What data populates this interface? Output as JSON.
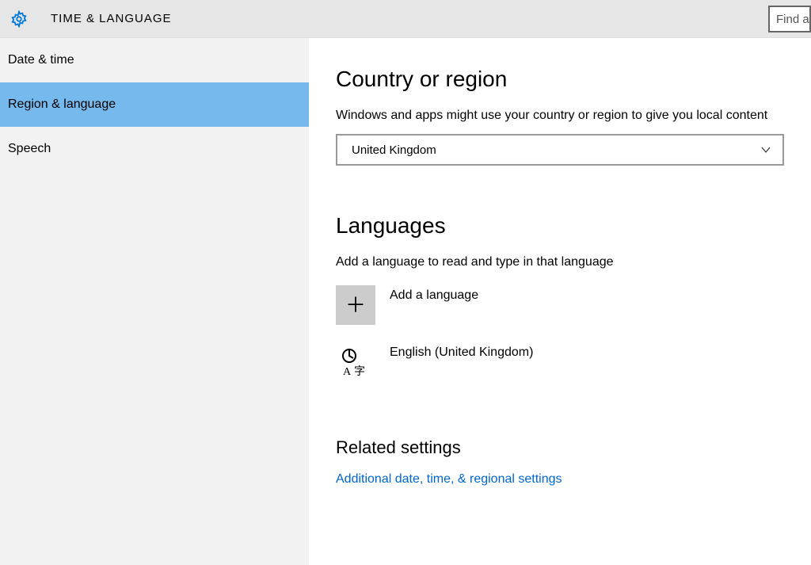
{
  "header": {
    "title": "TIME & LANGUAGE",
    "search_placeholder": "Find a"
  },
  "sidebar": {
    "items": [
      {
        "label": "Date & time",
        "selected": false
      },
      {
        "label": "Region & language",
        "selected": true
      },
      {
        "label": "Speech",
        "selected": false
      }
    ]
  },
  "content": {
    "country": {
      "title": "Country or region",
      "desc": "Windows and apps might use your country or region to give you local content",
      "selected": "United Kingdom"
    },
    "languages": {
      "title": "Languages",
      "desc": "Add a language to read and type in that language",
      "add_label": "Add a language",
      "installed": [
        {
          "name": "English (United Kingdom)"
        }
      ]
    },
    "related": {
      "title": "Related settings",
      "link": "Additional date, time, & regional settings"
    }
  }
}
